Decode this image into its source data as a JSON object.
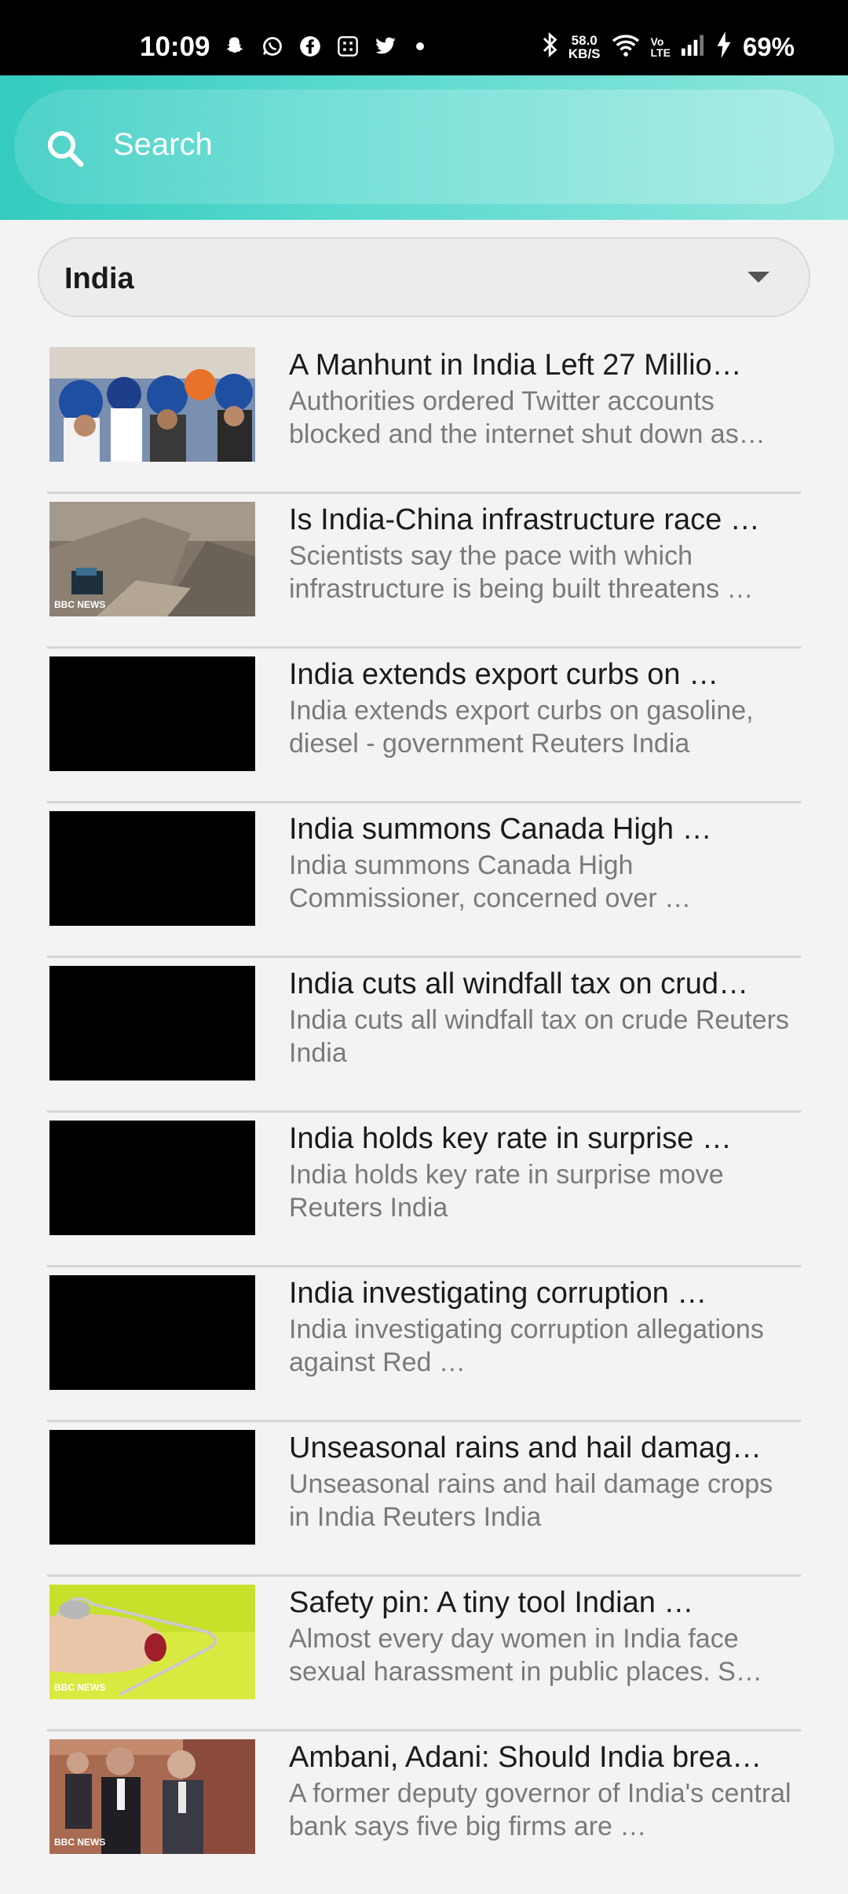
{
  "status_bar": {
    "time": "10:09",
    "speed_value": "58.0",
    "speed_unit": "KB/S",
    "battery": "69%",
    "icons": [
      "snapchat-icon",
      "whatsapp-icon",
      "facebook-icon",
      "app-icon",
      "twitter-icon",
      "bluetooth-icon",
      "wifi-icon",
      "volte-icon",
      "signal-icon",
      "charging-icon"
    ]
  },
  "search": {
    "placeholder": "Search"
  },
  "filter": {
    "selected": "India"
  },
  "colors": {
    "header_start": "#34cbc0",
    "header_end": "#8de6dd",
    "background": "#f3f3f3"
  },
  "articles": [
    {
      "title": "A Manhunt in India Left 27 Millio…",
      "description": "Authorities ordered Twitter accounts blocked and the internet shut down as…",
      "thumb": "photo"
    },
    {
      "title": "Is India-China infrastructure race …",
      "description": "Scientists say the pace with which infrastructure is being built threatens …",
      "thumb": "photo",
      "thumb_badge": "BBC NEWS"
    },
    {
      "title": "India extends export curbs on …",
      "description": "India extends export curbs on gasoline, diesel - government  Reuters India",
      "thumb": "black"
    },
    {
      "title": "India summons Canada High …",
      "description": "India summons Canada High Commissioner, concerned over …",
      "thumb": "black"
    },
    {
      "title": "India cuts all windfall tax on crud…",
      "description": "India cuts all windfall tax on crude  Reuters India",
      "thumb": "black"
    },
    {
      "title": "India holds key rate in surprise …",
      "description": "India holds key rate in surprise move  Reuters India",
      "thumb": "black"
    },
    {
      "title": "India investigating corruption …",
      "description": "India investigating corruption allegations against Red …",
      "thumb": "black"
    },
    {
      "title": "Unseasonal rains and hail damag…",
      "description": "Unseasonal rains and hail damage crops in India  Reuters India",
      "thumb": "black"
    },
    {
      "title": "Safety pin: A tiny tool Indian …",
      "description": "Almost every day women in India face sexual harassment in public places. S…",
      "thumb": "photo",
      "thumb_badge": "BBC NEWS"
    },
    {
      "title": "Ambani, Adani: Should India brea…",
      "description": "A former deputy governor of India's central bank says five big firms are …",
      "thumb": "photo",
      "thumb_badge": "BBC NEWS"
    }
  ]
}
